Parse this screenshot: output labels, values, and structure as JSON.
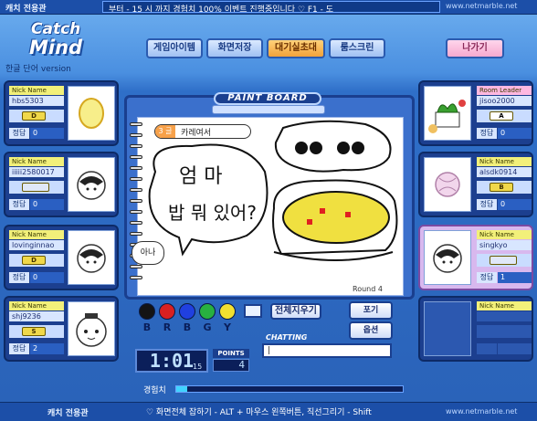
{
  "top_bar": {
    "tag": "캐치 전용관",
    "ticker": "부터 - 15 시 까지 경험치 100% 이벤트 진행중입니다   ♡ F1 - 도",
    "url": "www.netmarble.net"
  },
  "header": {
    "logo_line1": "Catch",
    "logo_line2": "Mind",
    "version": "한글 단어 version",
    "menu": [
      "게임아이템",
      "화면저장",
      "대기실초대",
      "룸스크린"
    ],
    "exit": "나가기"
  },
  "labels": {
    "nick_name": "Nick Name",
    "room_leader": "Room Leader",
    "score": "정답"
  },
  "players_left": [
    {
      "nick": "hbs5303",
      "item": "D",
      "score": "0",
      "avatar": "egg"
    },
    {
      "nick": "iiiii2580017",
      "item": "",
      "score": "0",
      "avatar": "rice-ball"
    },
    {
      "nick": "lovinginnao",
      "item": "D",
      "score": "0",
      "avatar": "rice-ball"
    },
    {
      "nick": "shj9236",
      "item": "S",
      "score": "2",
      "avatar": "snowman"
    }
  ],
  "players_right": [
    {
      "nick": "jisoo2000",
      "item": "A",
      "score": "0",
      "avatar": "cake",
      "leader": true
    },
    {
      "nick": "alsdk0914",
      "item": "B",
      "score": "0",
      "avatar": "ball"
    },
    {
      "nick": "singkyo",
      "item": "",
      "score": "1",
      "avatar": "rice-ball",
      "highlight": true
    },
    {
      "nick": "",
      "item": "",
      "score": "",
      "avatar": "",
      "empty": true
    }
  ],
  "board": {
    "title": "PAINT BOARD",
    "hint_num": "3 글",
    "hint_text": "카레여서",
    "round": "Round 4",
    "drawn_text_line1": "엄 마",
    "drawn_text_line2": "밥 뭐 있어?"
  },
  "bubble_text": "아나",
  "palette": {
    "letters": [
      "B",
      "R",
      "B",
      "G",
      "Y"
    ],
    "colors": [
      "#141414",
      "#d82020",
      "#2040e0",
      "#28b040",
      "#f2e030"
    ]
  },
  "buttons": {
    "clear": "전체지우기",
    "give_up": "포기",
    "options": "옵션"
  },
  "status": {
    "timer": "1:01",
    "timer_sub": "15",
    "points_label": "POINTS",
    "points": "4",
    "chat_label": "CHATTING",
    "chat_value": "|",
    "exp_label": "경험치",
    "exp_fraction": 0.05
  },
  "bottom_bar": {
    "tag": "캐치 전용관",
    "tip": "♡ 화면전체 잡하기 - ALT + 마우스 왼쪽버튼,   직선그리기 - Shift",
    "url": "www.netmarble.net"
  }
}
